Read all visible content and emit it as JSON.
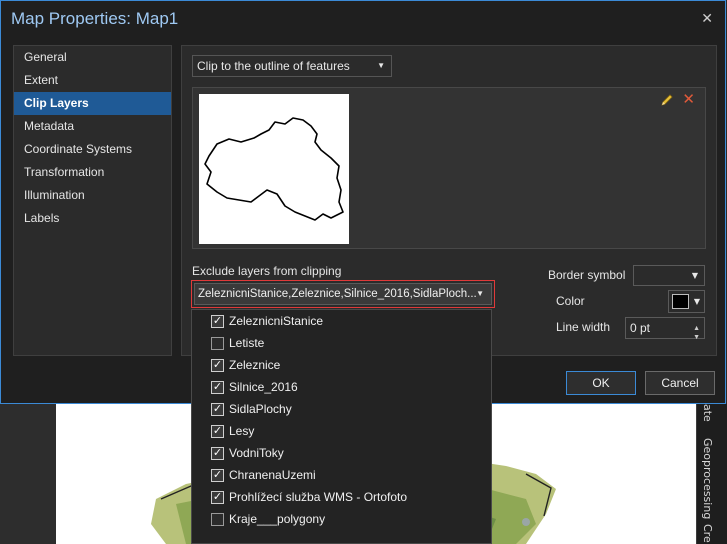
{
  "dialog": {
    "title": "Map Properties: Map1",
    "close_glyph": "✕"
  },
  "nav": {
    "items": [
      {
        "label": "General",
        "active": false
      },
      {
        "label": "Extent",
        "active": false
      },
      {
        "label": "Clip Layers",
        "active": true
      },
      {
        "label": "Metadata",
        "active": false
      },
      {
        "label": "Coordinate Systems",
        "active": false
      },
      {
        "label": "Transformation",
        "active": false
      },
      {
        "label": "Illumination",
        "active": false
      },
      {
        "label": "Labels",
        "active": false
      }
    ]
  },
  "clip": {
    "mode_value": "Clip to the outline of features",
    "preview_icons": [
      "pencil-icon",
      "delete-icon"
    ],
    "delete_glyph": "✕"
  },
  "exclude": {
    "label": "Exclude layers from clipping",
    "value": "ZeleznicniStanice,Zeleznice,Silnice_2016,SidlaPloch...",
    "options": [
      {
        "label": "ZeleznicniStanice",
        "checked": true
      },
      {
        "label": "Letiste",
        "checked": false
      },
      {
        "label": "Zeleznice",
        "checked": true
      },
      {
        "label": "Silnice_2016",
        "checked": true
      },
      {
        "label": "SidlaPlochy",
        "checked": true
      },
      {
        "label": "Lesy",
        "checked": true
      },
      {
        "label": "VodniToky",
        "checked": true
      },
      {
        "label": "ChranenaUzemi",
        "checked": true
      },
      {
        "label": "Prohlížecí služba WMS - Ortofoto",
        "checked": true
      },
      {
        "label": "Kraje___polygony",
        "checked": false
      }
    ]
  },
  "border": {
    "symbol_label": "Border symbol",
    "color_label": "Color",
    "color_value": "#000000",
    "line_width_label": "Line width",
    "line_width_value": "0 pt"
  },
  "buttons": {
    "ok": "OK",
    "cancel": "Cancel"
  },
  "background": {
    "right_tabs": [
      "ate",
      "Geoprocessing",
      "Cre"
    ]
  },
  "colors": {
    "accent": "#3b8ad6",
    "title": "#9fc9f3",
    "active_nav": "#1f5a96",
    "highlight_border": "#e03a3a",
    "delete_icon": "#e05a3a"
  }
}
